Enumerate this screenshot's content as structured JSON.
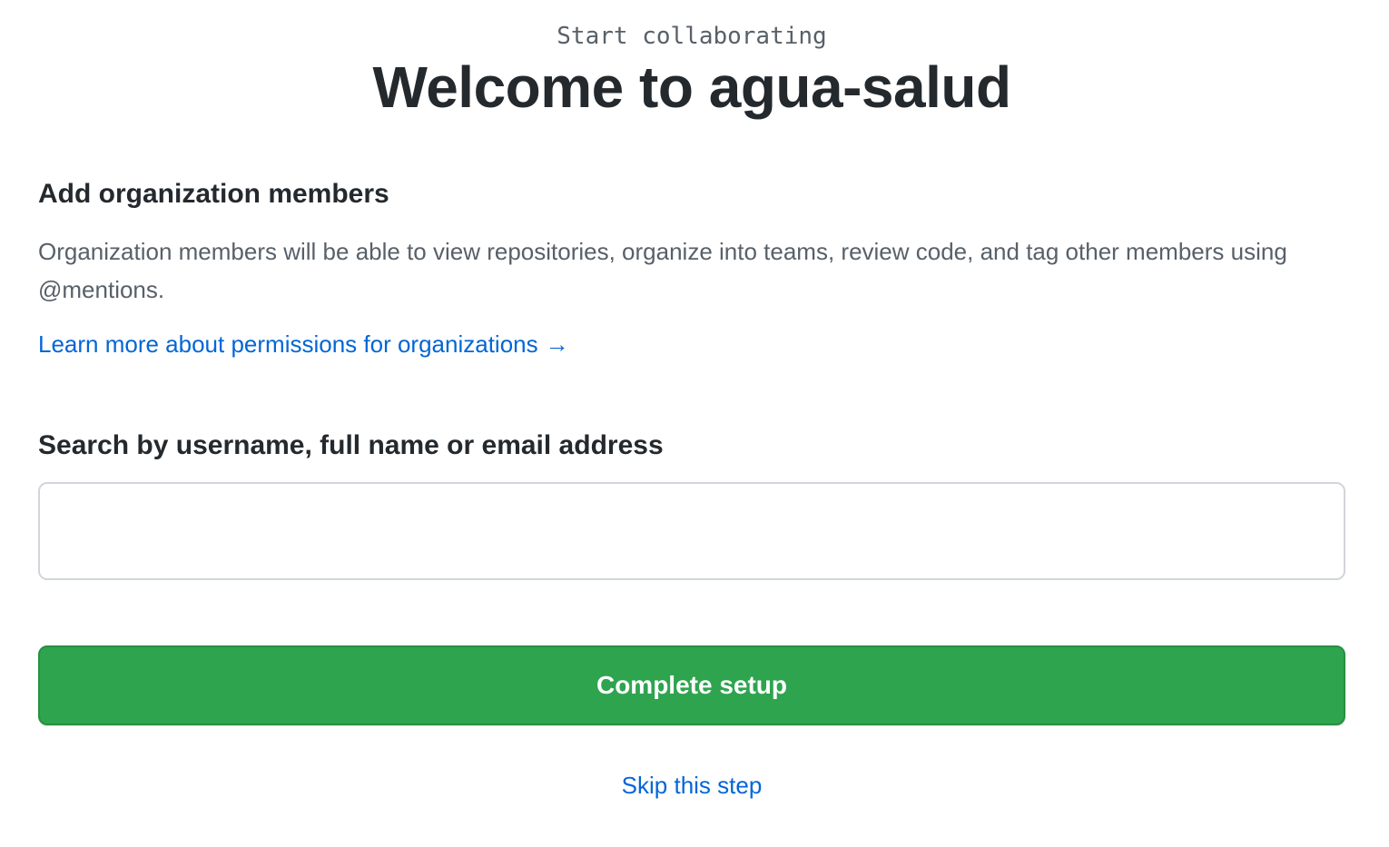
{
  "header": {
    "eyebrow": "Start collaborating",
    "title": "Welcome to agua-salud"
  },
  "members_section": {
    "heading": "Add organization members",
    "description": "Organization members will be able to view repositories, organize into teams, review code, and tag other members using @mentions.",
    "learn_more_label": "Learn more about permissions for organizations",
    "learn_more_arrow": "→"
  },
  "search": {
    "label": "Search by username, full name or email address",
    "value": "",
    "placeholder": ""
  },
  "actions": {
    "complete_label": "Complete setup",
    "skip_label": "Skip this step"
  },
  "colors": {
    "primary_button": "#2ea44f",
    "link": "#0366d6",
    "muted_text": "#586069",
    "heading_text": "#24292e"
  }
}
